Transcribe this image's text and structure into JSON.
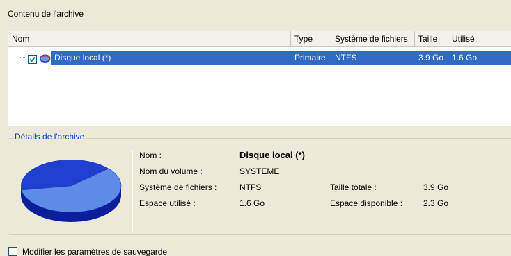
{
  "archive_contents": {
    "title": "Contenu de l'archive",
    "columns": [
      "Nom",
      "Type",
      "Système de fichiers",
      "Taille",
      "Utilisé"
    ],
    "rows": [
      {
        "name": "Disque local (*)",
        "type": "Primaire",
        "filesystem": "NTFS",
        "size": "3.9 Go",
        "used": "1.6 Go",
        "checked": true,
        "icon": "disk-icon"
      }
    ]
  },
  "details": {
    "title": "Détails de l'archive",
    "name_label": "Nom :",
    "name_value": "Disque local (*)",
    "volume_label": "Nom du volume :",
    "volume_value": "SYSTEME",
    "fs_label": "Système de fichiers :",
    "fs_value": "NTFS",
    "used_label": "Espace utilisé :",
    "used_value": "1.6 Go",
    "total_label": "Taille totale :",
    "total_value": "3.9 Go",
    "free_label": "Espace disponible :",
    "free_value": "2.3 Go",
    "pie": {
      "used_fraction": 0.41,
      "used_color": "#1f3fd0",
      "free_color": "#5d8be6"
    }
  },
  "modify_params": {
    "label": "Modifier les paramètres de sauvegarde",
    "checked": false
  },
  "colors": {
    "selection": "#316ac5",
    "accent": "#0046d5"
  }
}
